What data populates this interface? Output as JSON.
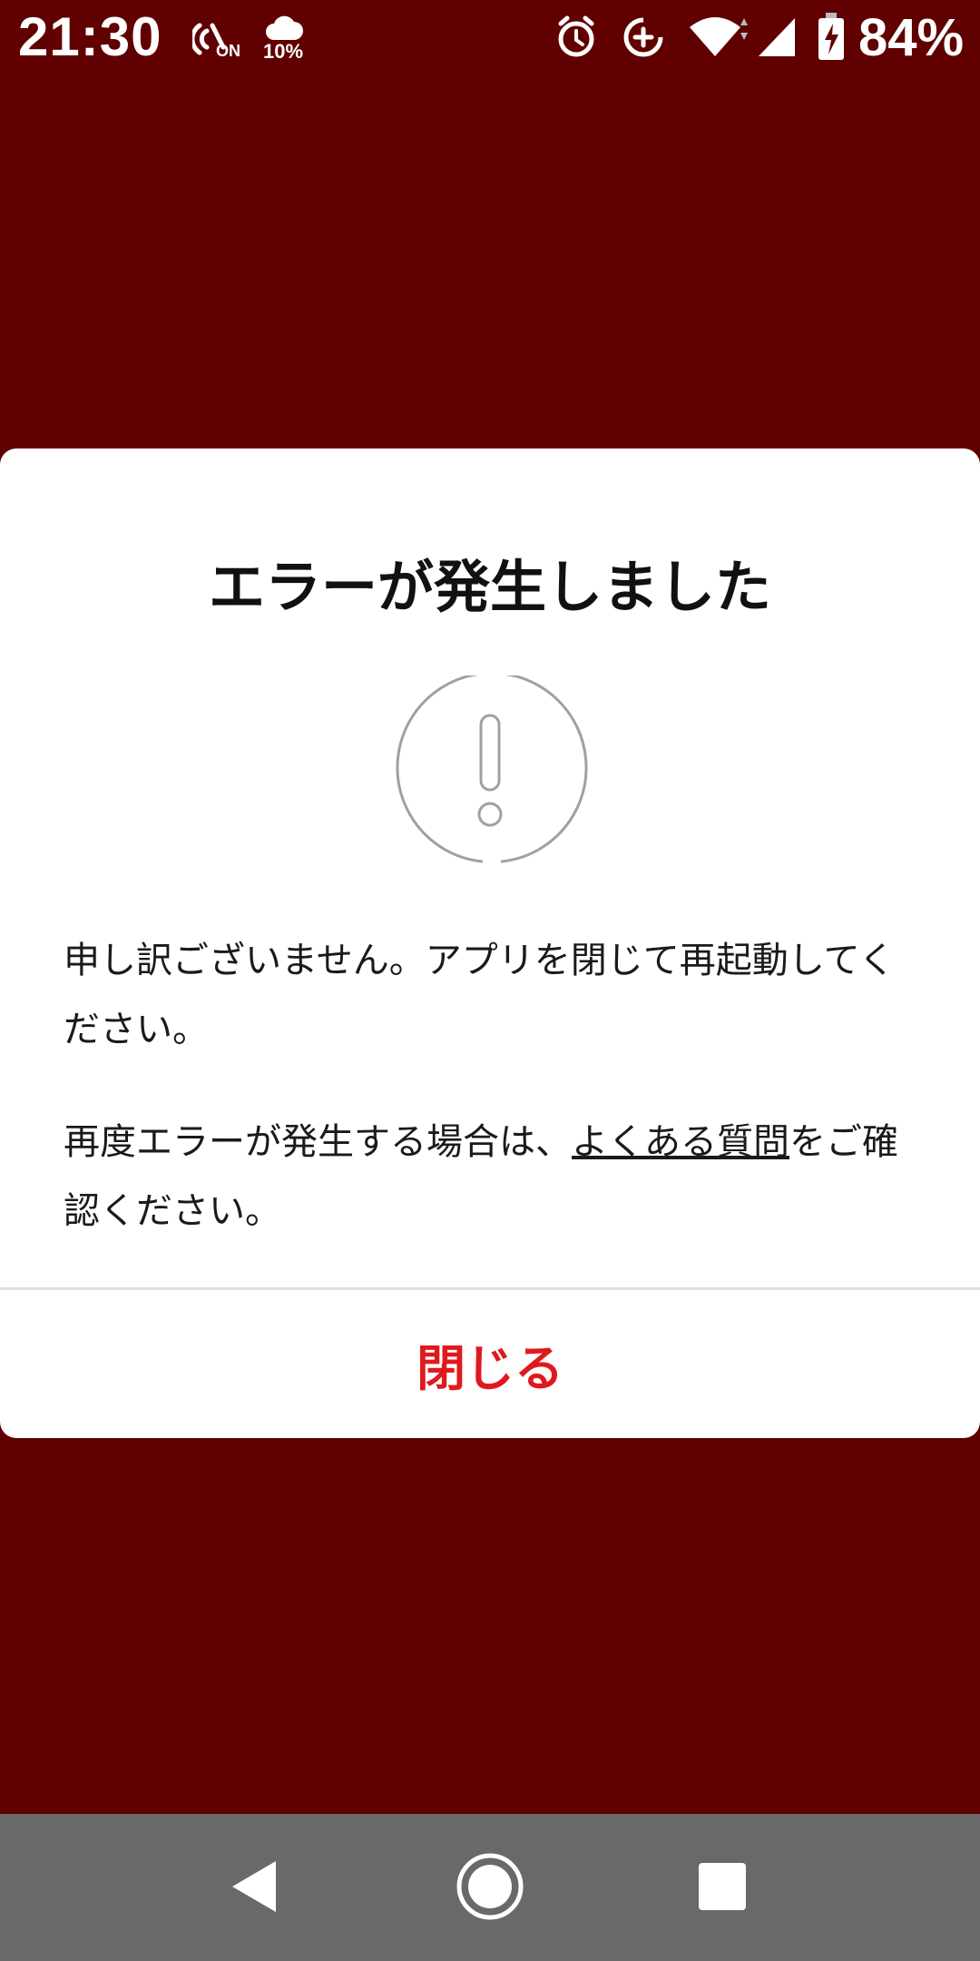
{
  "status_bar": {
    "time": "21:30",
    "nfc_text": "ON",
    "weather_text": "10%",
    "battery_text": "84%",
    "icons": [
      "nfc-icon",
      "weather-cloud-icon",
      "alarm-icon",
      "data-saver-icon",
      "wifi-icon",
      "signal-icon",
      "battery-charging-icon"
    ]
  },
  "dialog": {
    "title": "エラーが発生しました",
    "icon": "alert-circle-icon",
    "message_1": "申し訳ございません。アプリを閉じて再起動してください。",
    "message_2_before": "再度エラーが発生する場合は、",
    "faq_link": "よくある質問",
    "message_2_after": "をご確認ください。",
    "close_label": "閉じる"
  },
  "nav_bar": {
    "icons": [
      "back-icon",
      "home-icon",
      "recents-icon"
    ]
  },
  "colors": {
    "background": "#600000",
    "dialog": "#ffffff",
    "accent": "#e0191f",
    "nav_bar": "#696969"
  }
}
